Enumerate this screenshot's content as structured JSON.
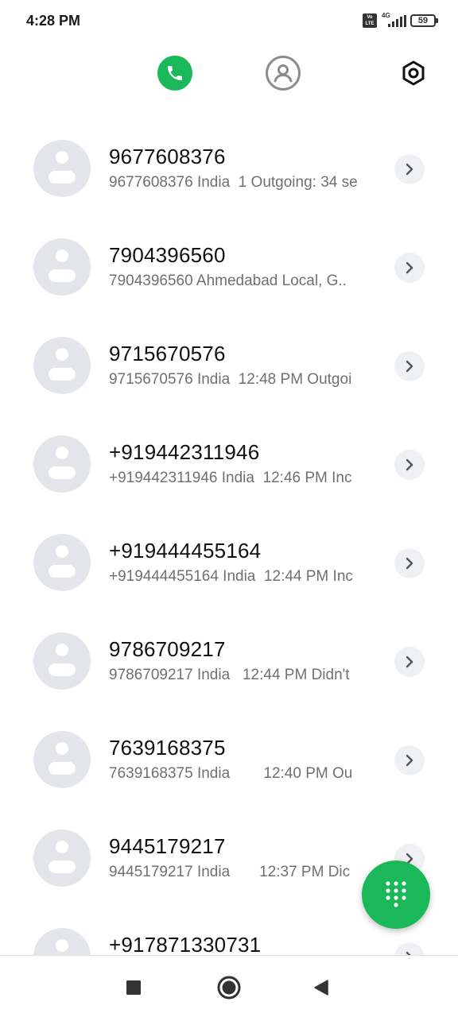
{
  "status_bar": {
    "time": "4:28 PM",
    "volte_label": "Vo LTE",
    "network": "4G",
    "battery": "59"
  },
  "tabs": [
    {
      "id": "calls",
      "icon": "phone-icon",
      "active": true
    },
    {
      "id": "contacts",
      "icon": "person-icon",
      "active": false
    },
    {
      "id": "settings",
      "icon": "settings-hexagon-icon",
      "active": false
    }
  ],
  "calls": [
    {
      "number": "9677608376",
      "detail": "9677608376 India  1 Outgoing: 34 se"
    },
    {
      "number": "7904396560",
      "detail": "7904396560 Ahmedabad Local, G.."
    },
    {
      "number": "9715670576",
      "detail": "9715670576 India  12:48 PM Outgoi"
    },
    {
      "number": "+919442311946",
      "detail": "+919442311946 India  12:46 PM Inc"
    },
    {
      "number": "+919444455164",
      "detail": "+919444455164 India  12:44 PM Inc"
    },
    {
      "number": "9786709217",
      "detail": "9786709217 India   12:44 PM Didn't"
    },
    {
      "number": "7639168375",
      "detail": "7639168375 India        12:40 PM Ou"
    },
    {
      "number": "9445179217",
      "detail": "9445179217 India       12:37 PM Dic"
    },
    {
      "number": "+917871330731",
      "detail": ""
    }
  ],
  "colors": {
    "accent": "#1ab859",
    "avatar_bg": "#e3e5ea",
    "secondary_text": "#707070"
  },
  "nav": [
    {
      "id": "recents",
      "icon": "square-icon"
    },
    {
      "id": "home",
      "icon": "circle-home-icon"
    },
    {
      "id": "back",
      "icon": "triangle-back-icon"
    }
  ]
}
